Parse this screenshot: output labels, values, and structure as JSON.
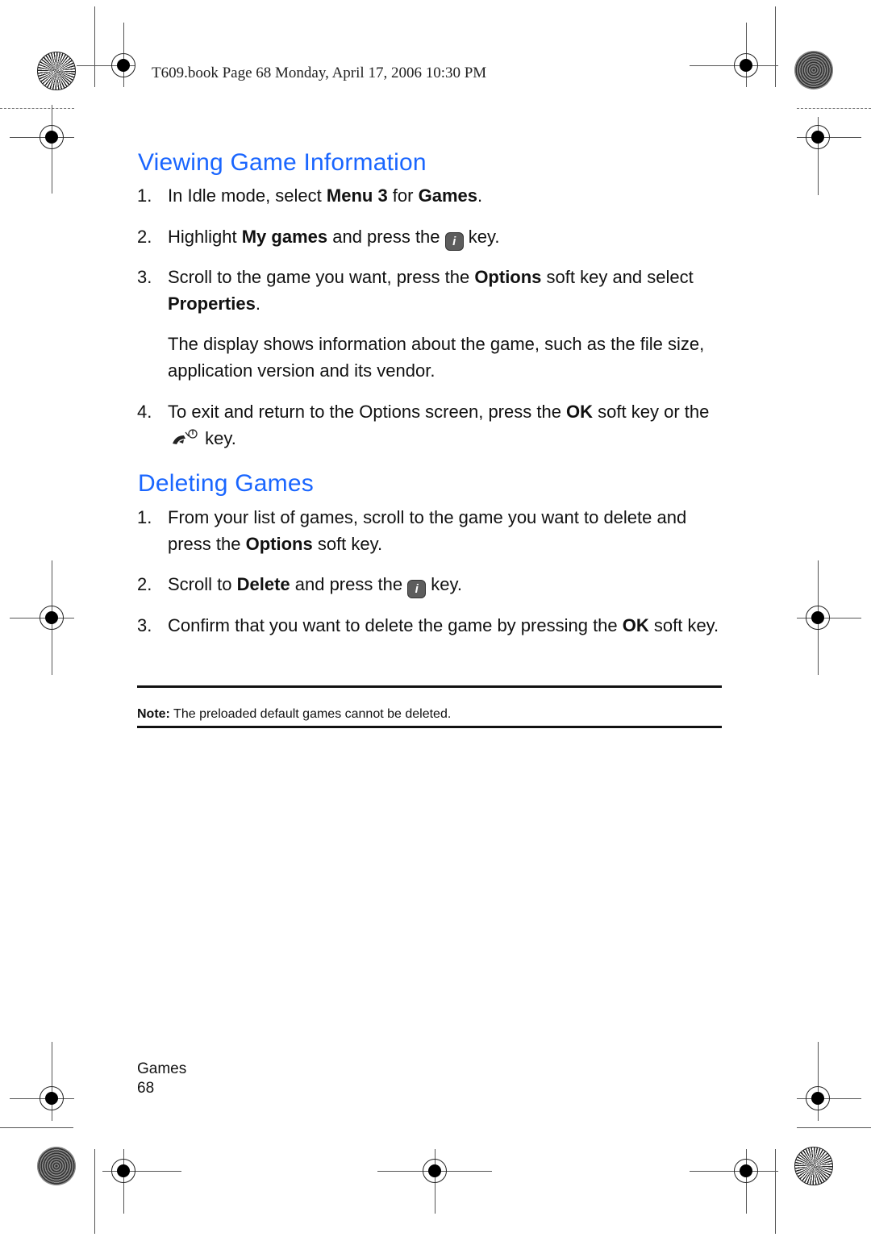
{
  "header": {
    "text": "T609.book  Page 68  Monday, April 17, 2006  10:30 PM"
  },
  "sections": [
    {
      "title": "Viewing Game Information",
      "steps": [
        {
          "num": "1.",
          "parts": [
            "In Idle mode, select ",
            "Menu 3",
            " for ",
            "Games",
            "."
          ]
        },
        {
          "num": "2.",
          "parts": [
            "Highlight ",
            "My games",
            " and press the ",
            " key."
          ]
        },
        {
          "num": "3.",
          "parts": [
            "Scroll to the game you want, press the ",
            "Options",
            " soft key and select ",
            "Properties",
            "."
          ]
        },
        {
          "num": "4.",
          "parts": [
            "To exit and return to the Options screen, press the ",
            "OK",
            " soft key or the ",
            " key."
          ]
        }
      ],
      "paragraph": "The display shows information about the game, such as the file size, application version and its vendor."
    },
    {
      "title": "Deleting Games",
      "steps": [
        {
          "num": "1.",
          "parts": [
            "From your list of games, scroll to the game you want to delete and press the ",
            "Options",
            " soft key."
          ]
        },
        {
          "num": "2.",
          "parts": [
            "Scroll to ",
            "Delete",
            " and press the ",
            " key."
          ]
        },
        {
          "num": "3.",
          "parts": [
            "Confirm that you want to delete the game by pressing the ",
            "OK",
            " soft key."
          ]
        }
      ]
    }
  ],
  "note": {
    "label": "Note:",
    "text": " The preloaded default games cannot be deleted."
  },
  "icons": {
    "menu_key": "i",
    "end_key": "end-power-key-icon"
  },
  "footer": {
    "section": "Games",
    "page": "68"
  },
  "colors": {
    "heading": "#1a66ff"
  }
}
